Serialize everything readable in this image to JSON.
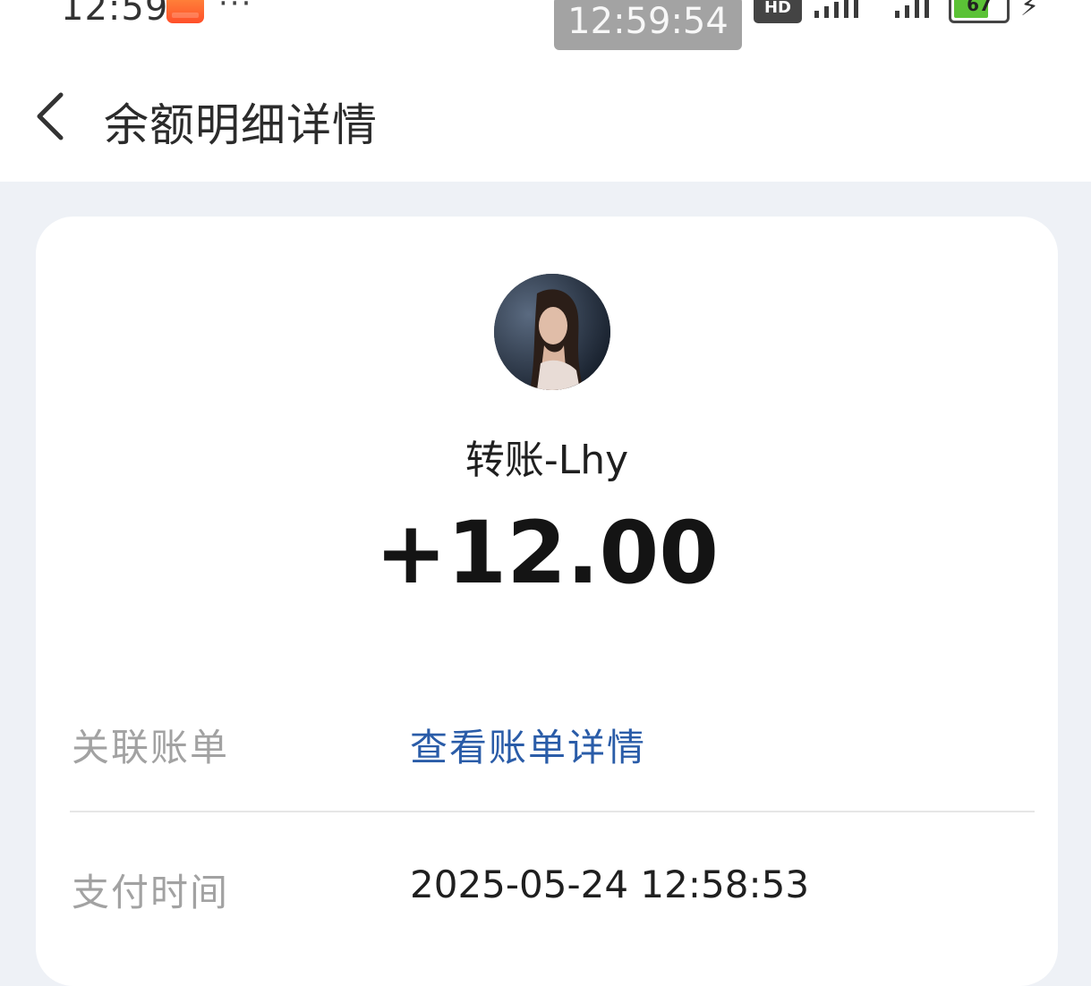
{
  "status_bar": {
    "time": "12:59",
    "more": "···",
    "overlay_time": "12:59:54",
    "hd": "HD",
    "battery": "67"
  },
  "header": {
    "title": "余额明细详情"
  },
  "detail": {
    "payee": "转账-Lhy",
    "amount": "+12.00",
    "rows": [
      {
        "label": "关联账单",
        "value": "查看账单详情"
      },
      {
        "label": "支付时间",
        "value": "2025-05-24 12:58:53"
      }
    ]
  },
  "colors": {
    "page_bg": "#eef1f6",
    "card_bg": "#ffffff",
    "link": "#2a5ca8",
    "label": "#a2a2a2",
    "battery": "#5bc236"
  }
}
